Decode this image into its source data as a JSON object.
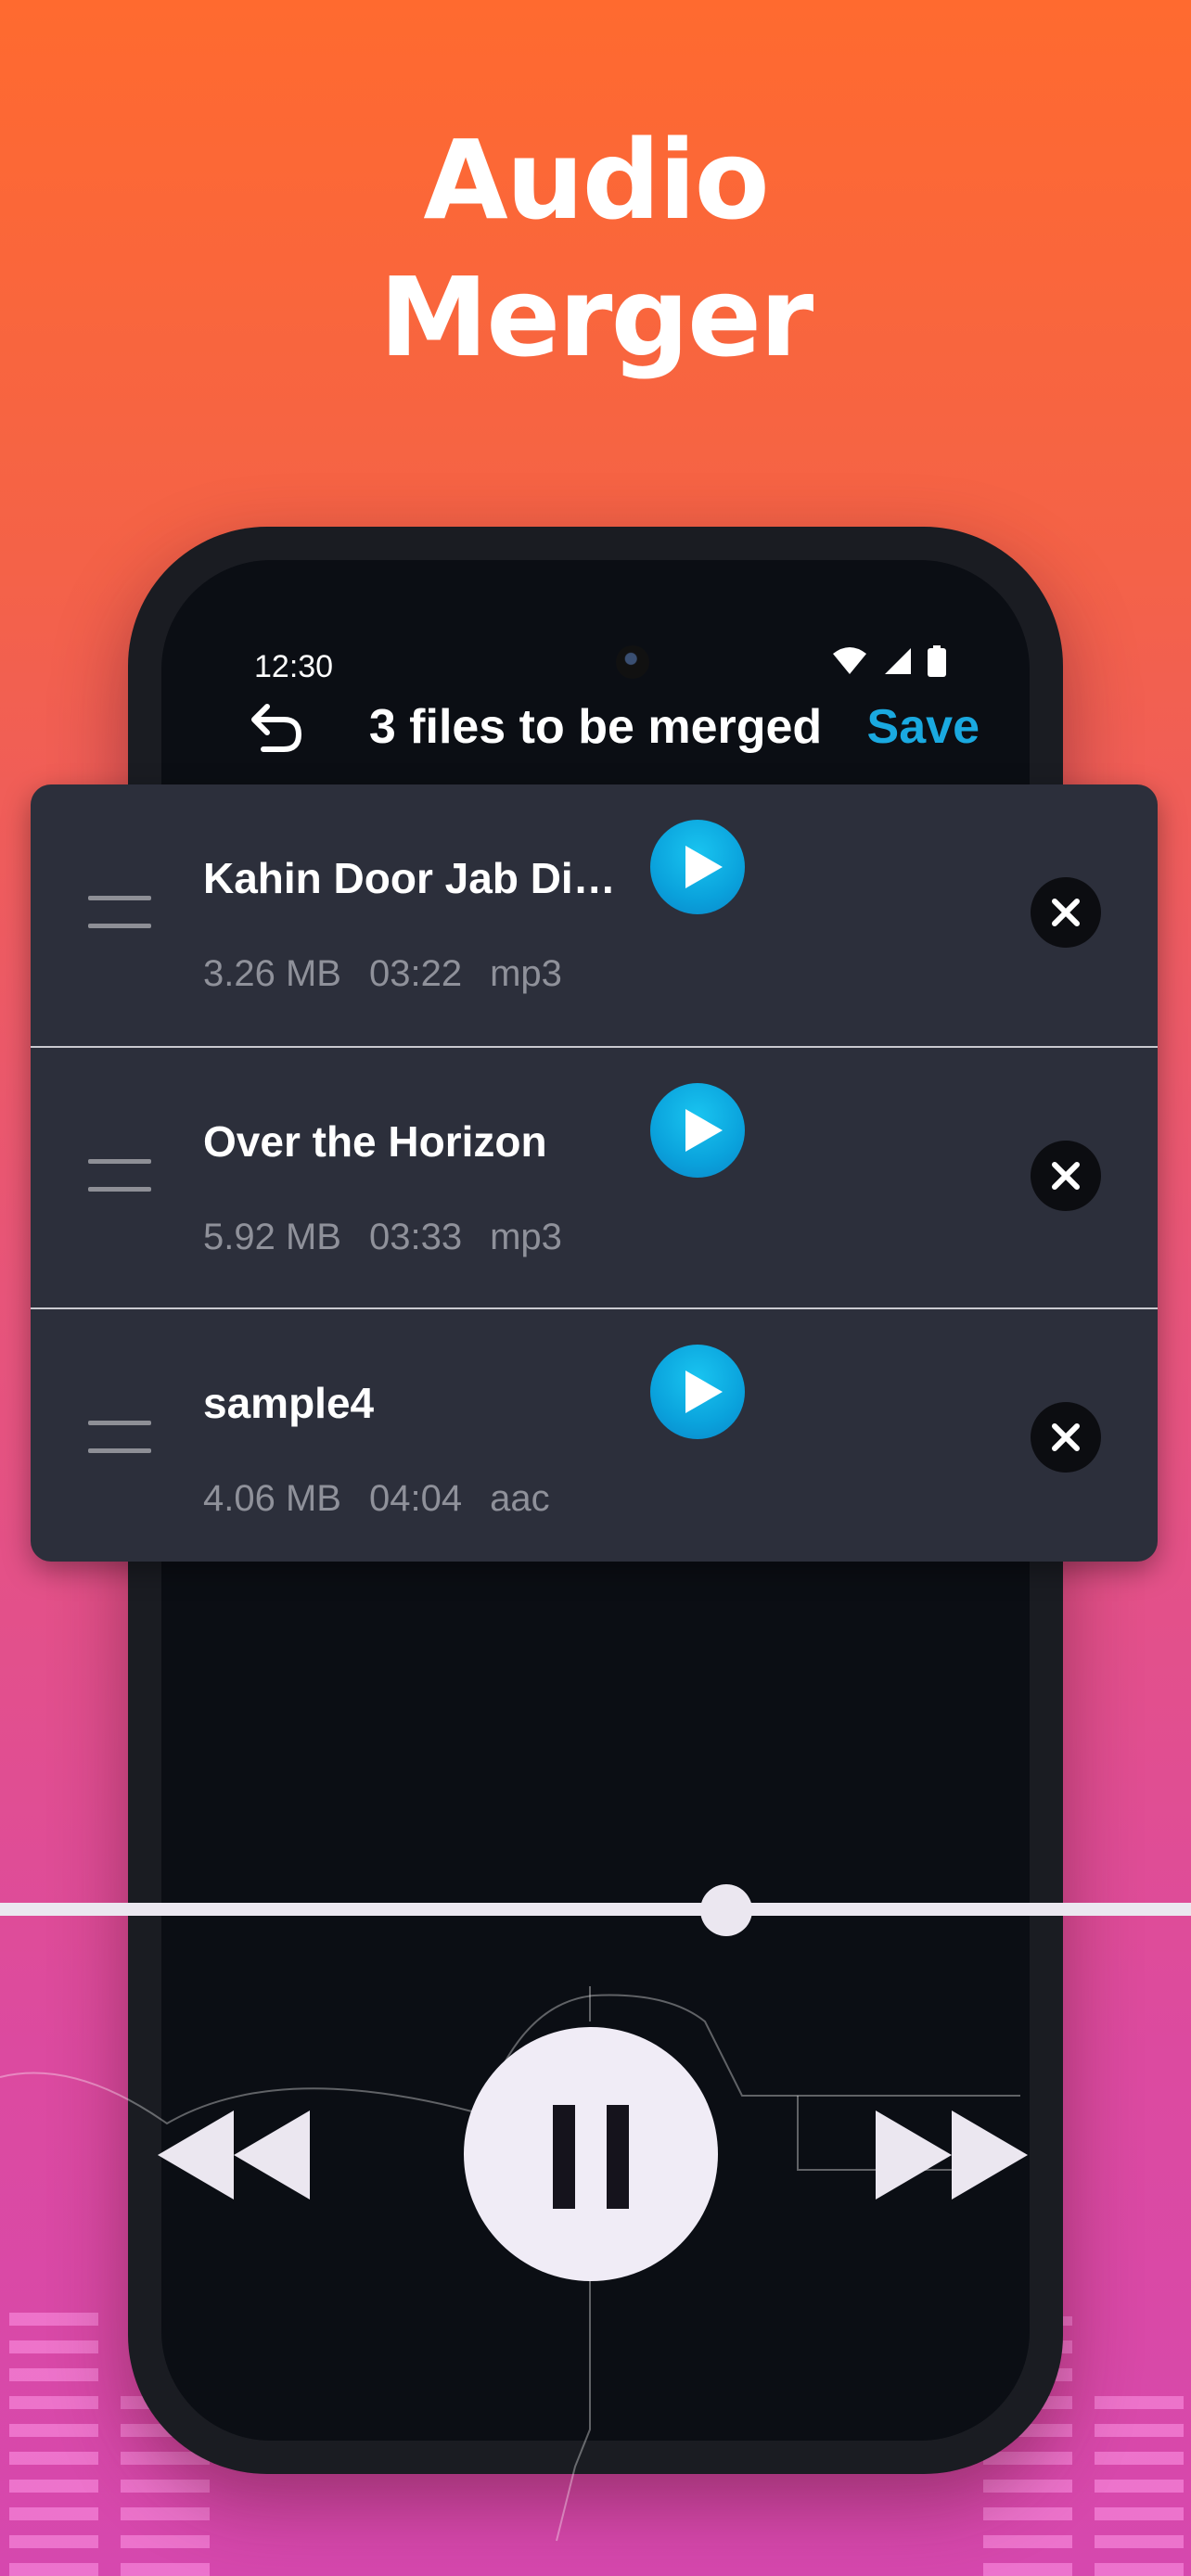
{
  "promo": {
    "line1": "Audio",
    "line2": "Merger"
  },
  "status": {
    "time": "12:30"
  },
  "appbar": {
    "title": "3 files to be merged",
    "save_label": "Save"
  },
  "files": [
    {
      "name": "Kahin Door Jab Din...",
      "size": "3.26 MB",
      "duration": "03:22",
      "format": "mp3"
    },
    {
      "name": "Over the Horizon",
      "size": "5.92 MB",
      "duration": "03:33",
      "format": "mp3"
    },
    {
      "name": "sample4",
      "size": "4.06 MB",
      "duration": "04:04",
      "format": "aac"
    }
  ],
  "player": {
    "progress": 0.61,
    "state": "playing"
  },
  "icons": {
    "back": "undo-arrow-icon",
    "play": "play-icon",
    "remove": "close-icon",
    "drag": "drag-handle-icon",
    "rewind": "rewind-icon",
    "pause": "pause-icon",
    "forward": "fast-forward-icon"
  },
  "colors": {
    "accent": "#1aa9e0",
    "card": "#2c2f3b",
    "screen": "#0b0e14"
  }
}
